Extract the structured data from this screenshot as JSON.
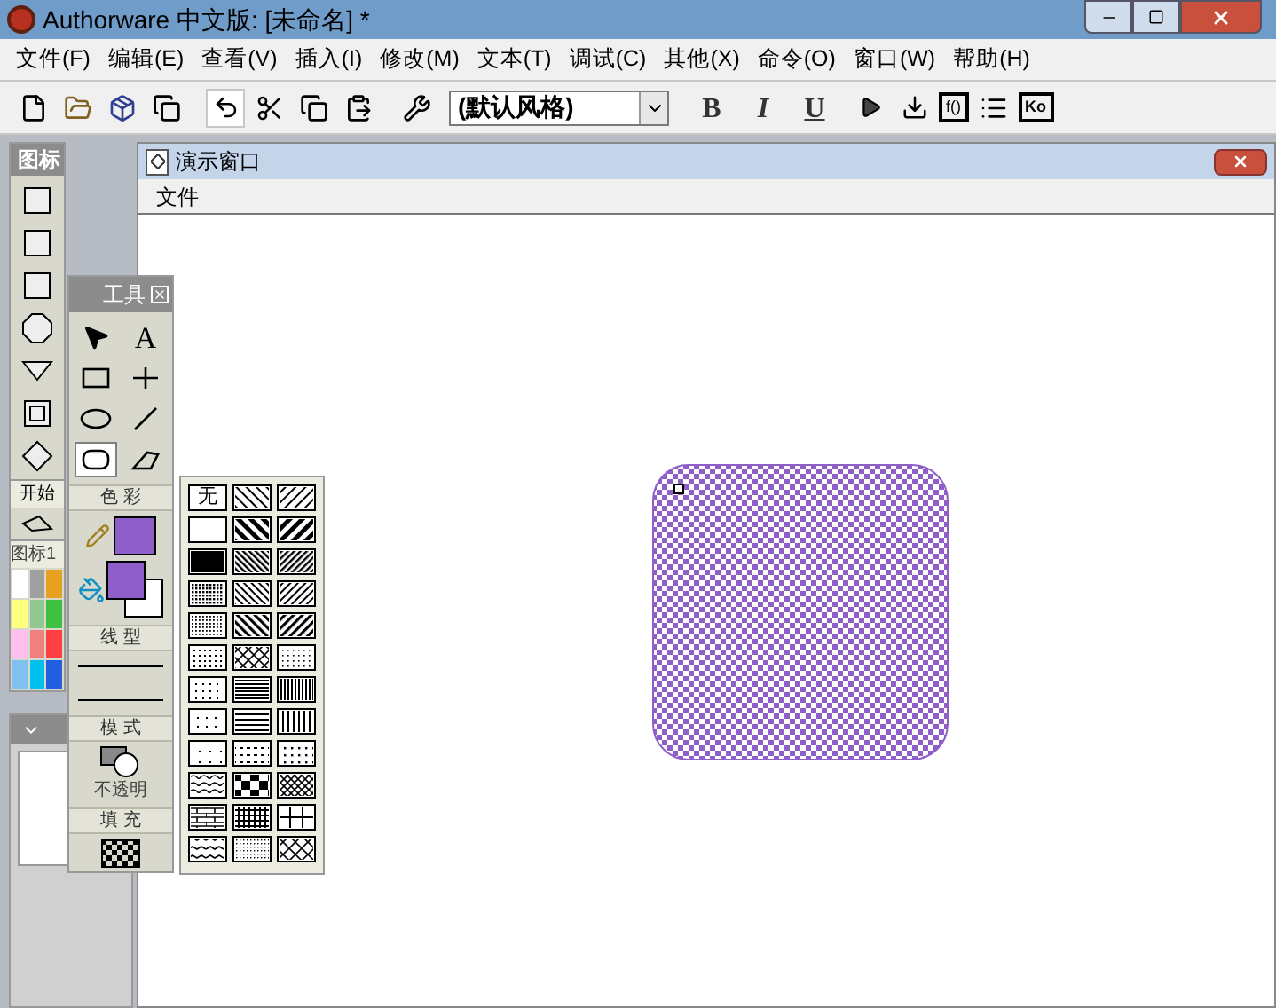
{
  "window": {
    "title": "Authorware 中文版: [未命名] *"
  },
  "menu": [
    "文件(F)",
    "编辑(E)",
    "查看(V)",
    "插入(I)",
    "修改(M)",
    "文本(T)",
    "调试(C)",
    "其他(X)",
    "命令(O)",
    "窗口(W)",
    "帮助(H)"
  ],
  "toolbar": {
    "style_dropdown": "(默认风格)",
    "format_buttons": [
      "B",
      "I",
      "U"
    ],
    "badge_buttons": [
      "f()",
      "Ko"
    ]
  },
  "icon_palette": {
    "title": "图标",
    "start_label": "开始",
    "color_title": "图标1",
    "colors": [
      {
        "color": "#ffffff"
      },
      {
        "color": "#a0a0a0"
      },
      {
        "color": "#e8a020"
      },
      {
        "color": "#ffff80"
      },
      {
        "color": "#90c890"
      },
      {
        "color": "#40c040"
      },
      {
        "color": "#ffc0f0"
      },
      {
        "color": "#f08080"
      },
      {
        "color": "#ff4040"
      },
      {
        "color": "#80c0f0"
      },
      {
        "color": "#00c0f0"
      },
      {
        "color": "#2060e0"
      }
    ]
  },
  "tools_panel": {
    "title": "工具",
    "tools": [
      {
        "kind": "pointer",
        "selected": false
      },
      {
        "kind": "text",
        "label": "A",
        "selected": false
      },
      {
        "kind": "rectangle",
        "selected": false
      },
      {
        "kind": "cross",
        "selected": false
      },
      {
        "kind": "ellipse",
        "selected": false
      },
      {
        "kind": "line",
        "selected": false
      },
      {
        "kind": "rounded_rect",
        "selected": true
      },
      {
        "kind": "polygon",
        "selected": false
      }
    ],
    "color_heading": "色 彩",
    "pen": {
      "color": "#8e5fc9"
    },
    "fill_foreground": {
      "color": "#8e5fc9"
    },
    "fill_background": {
      "color": "#ffffff"
    },
    "line_heading": "线 型",
    "mode_heading": "模 式",
    "mode_label": "不透明",
    "fill_heading": "填 充"
  },
  "pattern_palette": {
    "none_label": "无"
  },
  "presentation_window": {
    "title": "演示窗口",
    "menu": [
      "文件"
    ]
  }
}
